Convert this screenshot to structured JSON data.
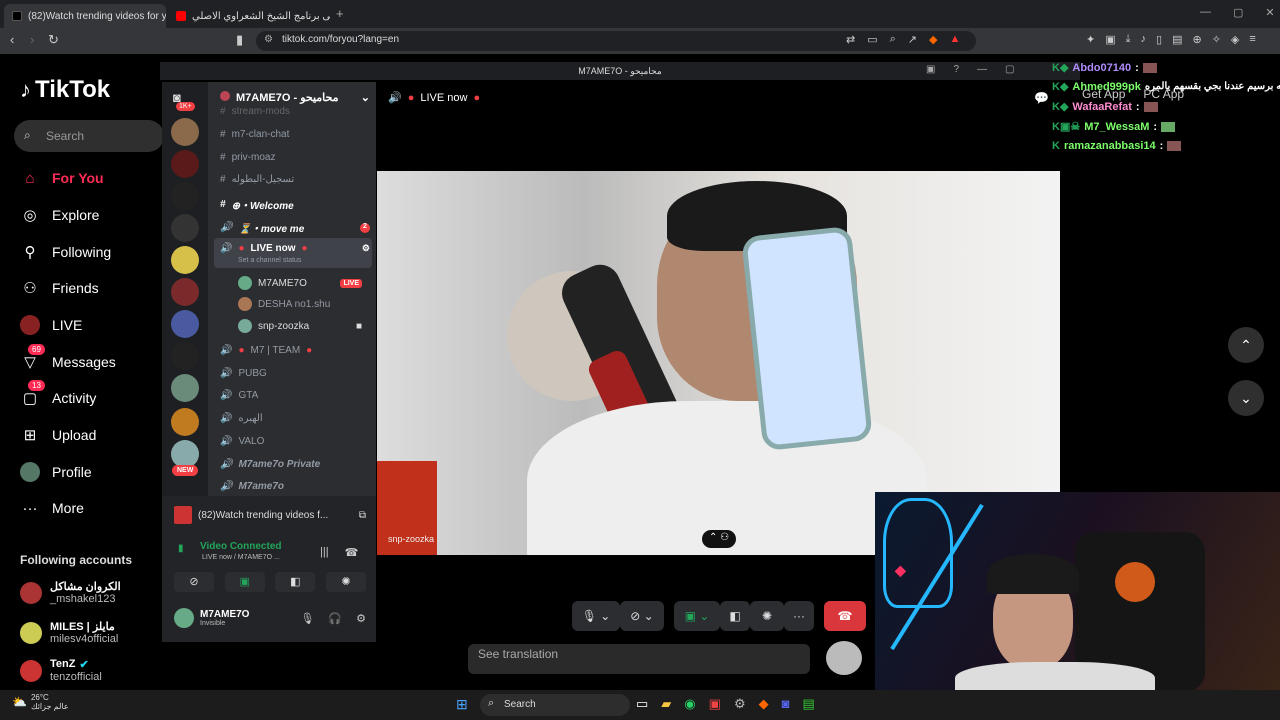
{
  "browser": {
    "tabs": [
      {
        "label": "(82)Watch trending videos for y"
      },
      {
        "label": "موسيقى برنامج الشيخ الشعراوي الاصلي"
      }
    ],
    "url": "tiktok.com/foryou?lang=en"
  },
  "tiktok": {
    "logo": "TikTok",
    "search_placeholder": "Search",
    "nav": [
      {
        "label": "For You",
        "icon": "home-icon"
      },
      {
        "label": "Explore",
        "icon": "compass-icon"
      },
      {
        "label": "Following",
        "icon": "following-icon"
      },
      {
        "label": "Friends",
        "icon": "friends-icon"
      },
      {
        "label": "LIVE",
        "icon": "live-icon"
      },
      {
        "label": "Messages",
        "icon": "messages-icon",
        "badge": "69"
      },
      {
        "label": "Activity",
        "icon": "activity-icon",
        "badge": "13"
      },
      {
        "label": "Upload",
        "icon": "upload-icon"
      },
      {
        "label": "Profile",
        "icon": "profile-icon"
      },
      {
        "label": "More",
        "icon": "more-icon"
      }
    ],
    "following_title": "Following accounts",
    "accounts": [
      {
        "name": "الكروان مشاكل",
        "handle": "_mshakel123"
      },
      {
        "name": "MILES | مايلز",
        "handle": "milesv4official"
      },
      {
        "name": "TenZ",
        "handle": "tenzofficial"
      }
    ],
    "get_app": "Get App",
    "pc_app": "PC App",
    "see_translation": "See translation"
  },
  "discord": {
    "window_title": "M7AME7O - محاميحو",
    "server_name": "M7AME7O - محاميحو",
    "server_badge": "1K+",
    "channels": [
      {
        "icon": "#",
        "name": "stream-mods"
      },
      {
        "icon": "#",
        "name": "m7-clan-chat"
      },
      {
        "icon": "#",
        "name": "priv-moaz"
      },
      {
        "icon": "#",
        "name": "تسجيل-البطوله"
      },
      {
        "icon": "#",
        "name": "⊕・Welcome"
      },
      {
        "icon": "🔊",
        "name": "⏳・move me",
        "count": "2"
      },
      {
        "icon": "🔊",
        "name": "LIVE now",
        "sub": "Set a channel status"
      }
    ],
    "voice_users": [
      {
        "name": "M7AME7O",
        "tag": "LIVE"
      },
      {
        "name": "DESHA no1.shu"
      },
      {
        "name": "snp-zoozka"
      }
    ],
    "channels2": [
      {
        "icon": "🔊",
        "name": "M7 | TEAM"
      },
      {
        "icon": "🔊",
        "name": "PUBG"
      },
      {
        "icon": "🔊",
        "name": "GTA"
      },
      {
        "icon": "🔊",
        "name": "الهبره"
      },
      {
        "icon": "🔊",
        "name": "VALO"
      },
      {
        "icon": "🔊",
        "name": "M7ame7o Private"
      },
      {
        "icon": "🔊",
        "name": "M7ame7o"
      }
    ],
    "activity": "(82)Watch trending videos f...",
    "voice_status": "Video Connected",
    "voice_sub": "LIVE now / M7AME7O ...",
    "user": {
      "name": "M7AME7O",
      "status": "Invisible"
    },
    "header_live": "LIVE now",
    "video_label": "snp-zoozka",
    "new_badge": "NEW"
  },
  "chat": [
    {
      "user": "Abdo07140",
      "color": "#b18cff",
      "msg": ""
    },
    {
      "user": "Ahmed999pk",
      "color": "#7cff6a",
      "msg": "شويه برسيم عندنا بجي بقسهم يالمره :"
    },
    {
      "user": "WafaaRefat",
      "color": "#ff8cd0",
      "msg": ""
    },
    {
      "user": "M7_WessaM",
      "color": "#7cff6a",
      "msg": ""
    },
    {
      "user": "ramazanabbasi14",
      "color": "#7cff6a",
      "msg": ""
    }
  ],
  "taskbar": {
    "weather_temp": "26°C",
    "weather_text": "عالم جزائك",
    "search": "Search"
  }
}
